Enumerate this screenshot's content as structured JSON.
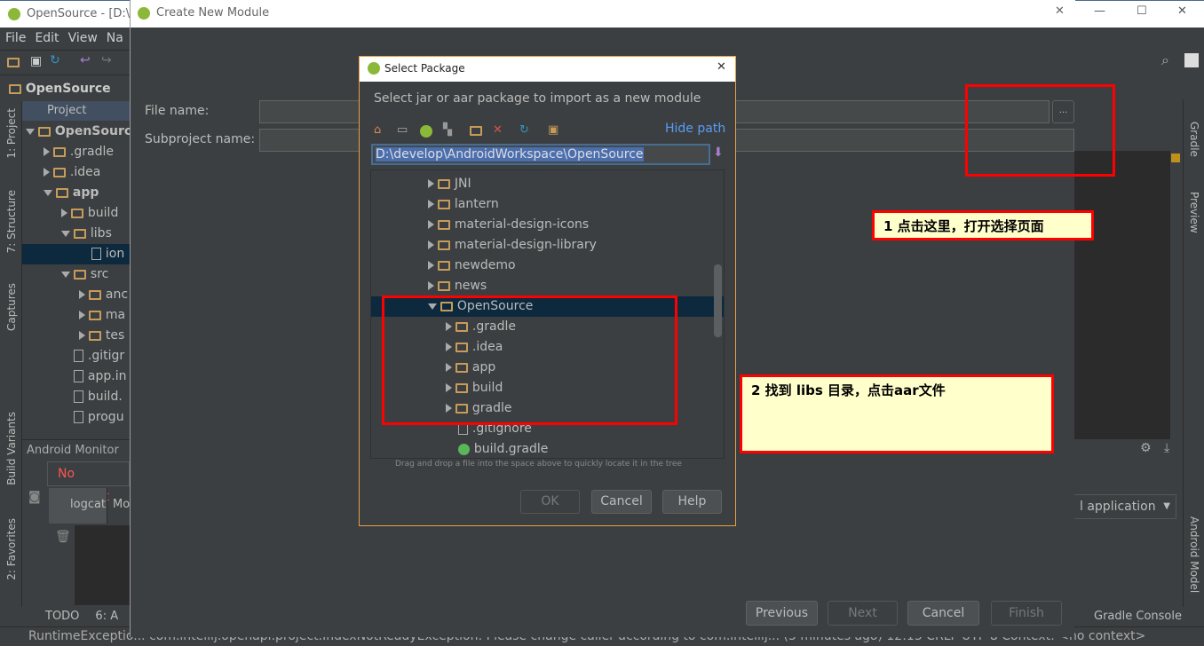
{
  "ide": {
    "title": "OpenSource - [D:\\de",
    "menu": [
      "File",
      "Edit",
      "View",
      "Na"
    ],
    "breadcrumb": [
      "OpenSource"
    ],
    "left_strip": [
      "1: Project",
      "7: Structure",
      "Captures",
      "Build Variants",
      "2: Favorites"
    ],
    "right_strip": [
      "Gradle",
      "Preview",
      "Android Model"
    ],
    "project_header": "Project",
    "tree": [
      {
        "label": "OpenSource",
        "level": 0,
        "state": "open",
        "bold": true
      },
      {
        "label": ".gradle",
        "level": 1,
        "state": "closed"
      },
      {
        "label": ".idea",
        "level": 1,
        "state": "closed"
      },
      {
        "label": "app",
        "level": 1,
        "state": "open",
        "bold": true
      },
      {
        "label": "build",
        "level": 2,
        "state": "closed"
      },
      {
        "label": "libs",
        "level": 2,
        "state": "open"
      },
      {
        "label": "ion",
        "level": 3,
        "state": "file",
        "selected": true
      },
      {
        "label": "src",
        "level": 2,
        "state": "open"
      },
      {
        "label": "anc",
        "level": 3,
        "state": "closed"
      },
      {
        "label": "ma",
        "level": 3,
        "state": "closed"
      },
      {
        "label": "tes",
        "level": 3,
        "state": "closed"
      },
      {
        "label": ".gitigr",
        "level": 2,
        "state": "file"
      },
      {
        "label": "app.in",
        "level": 2,
        "state": "file"
      },
      {
        "label": "build.",
        "level": 2,
        "state": "file"
      },
      {
        "label": "progu",
        "level": 2,
        "state": "file"
      }
    ],
    "monitor_title": "Android Monitor",
    "no_connect": "No Connect",
    "logcat_tab": "logcat",
    "monitor_tab": "Mo",
    "bottom_tabs": [
      "TODO",
      "6: A"
    ],
    "gradle_console": "Gradle Console",
    "app_select": "l application",
    "status": "RuntimeExceptio... com.intellij.openapi.project.IndexNotReadyException: Please change caller according to com.intellij... (5 minutes ago)   12:13   CRLF   UTF-8   Context: <no context>"
  },
  "create_module": {
    "title": "Create New Module",
    "file_name_label": "File name:",
    "file_name_value": "",
    "browse_label": "...",
    "subproject_label": "Subproject name:",
    "subproject_value": "",
    "buttons": {
      "previous": "Previous",
      "next": "Next",
      "cancel": "Cancel",
      "finish": "Finish"
    }
  },
  "select_package": {
    "title": "Select Package",
    "description": "Select jar or aar package to import as a new module",
    "hide_path": "Hide path",
    "path": "D:\\develop\\AndroidWorkspace\\OpenSource",
    "toolbar_icons": [
      "home-icon",
      "desktop-icon",
      "android-project-icon",
      "module-icon",
      "new-folder-icon",
      "delete-icon",
      "refresh-icon",
      "show-hidden-icon"
    ],
    "tree": [
      {
        "label": "JNI",
        "level": 1,
        "state": "closed"
      },
      {
        "label": "lantern",
        "level": 1,
        "state": "closed"
      },
      {
        "label": "material-design-icons",
        "level": 1,
        "state": "closed"
      },
      {
        "label": "material-design-library",
        "level": 1,
        "state": "closed"
      },
      {
        "label": "newdemo",
        "level": 1,
        "state": "closed"
      },
      {
        "label": "news",
        "level": 1,
        "state": "closed"
      },
      {
        "label": "OpenSource",
        "level": 1,
        "state": "open",
        "selected": true
      },
      {
        "label": ".gradle",
        "level": 2,
        "state": "closed"
      },
      {
        "label": ".idea",
        "level": 2,
        "state": "closed"
      },
      {
        "label": "app",
        "level": 2,
        "state": "closed"
      },
      {
        "label": "build",
        "level": 2,
        "state": "closed"
      },
      {
        "label": "gradle",
        "level": 2,
        "state": "closed"
      },
      {
        "label": ".gitignore",
        "level": 2,
        "state": "file"
      },
      {
        "label": "build.gradle",
        "level": 2,
        "state": "gradle"
      }
    ],
    "hint": "Drag and drop a file into the space above to quickly locate it in the tree",
    "buttons": {
      "ok": "OK",
      "cancel": "Cancel",
      "help": "Help"
    }
  },
  "annotations": {
    "note1": "1  点击这里，打开选择页面",
    "note2": "2 找到 libs 目录，点击aar文件",
    "highlight_color": "#ff0000",
    "note_bg": "#ffffcc"
  }
}
